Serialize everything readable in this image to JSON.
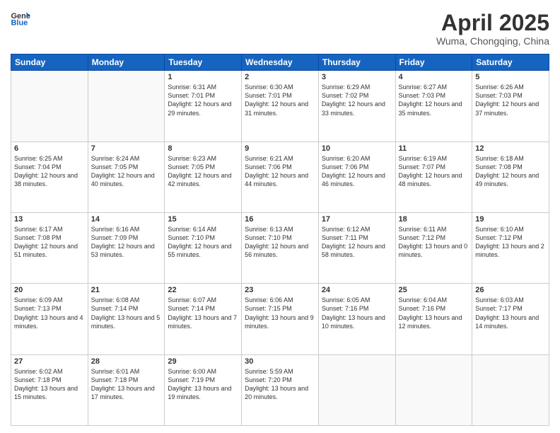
{
  "header": {
    "logo_general": "General",
    "logo_blue": "Blue",
    "title": "April 2025",
    "location": "Wuma, Chongqing, China"
  },
  "days_of_week": [
    "Sunday",
    "Monday",
    "Tuesday",
    "Wednesday",
    "Thursday",
    "Friday",
    "Saturday"
  ],
  "weeks": [
    [
      {
        "day": "",
        "info": ""
      },
      {
        "day": "",
        "info": ""
      },
      {
        "day": "1",
        "info": "Sunrise: 6:31 AM\nSunset: 7:01 PM\nDaylight: 12 hours\nand 29 minutes."
      },
      {
        "day": "2",
        "info": "Sunrise: 6:30 AM\nSunset: 7:01 PM\nDaylight: 12 hours\nand 31 minutes."
      },
      {
        "day": "3",
        "info": "Sunrise: 6:29 AM\nSunset: 7:02 PM\nDaylight: 12 hours\nand 33 minutes."
      },
      {
        "day": "4",
        "info": "Sunrise: 6:27 AM\nSunset: 7:03 PM\nDaylight: 12 hours\nand 35 minutes."
      },
      {
        "day": "5",
        "info": "Sunrise: 6:26 AM\nSunset: 7:03 PM\nDaylight: 12 hours\nand 37 minutes."
      }
    ],
    [
      {
        "day": "6",
        "info": "Sunrise: 6:25 AM\nSunset: 7:04 PM\nDaylight: 12 hours\nand 38 minutes."
      },
      {
        "day": "7",
        "info": "Sunrise: 6:24 AM\nSunset: 7:05 PM\nDaylight: 12 hours\nand 40 minutes."
      },
      {
        "day": "8",
        "info": "Sunrise: 6:23 AM\nSunset: 7:05 PM\nDaylight: 12 hours\nand 42 minutes."
      },
      {
        "day": "9",
        "info": "Sunrise: 6:21 AM\nSunset: 7:06 PM\nDaylight: 12 hours\nand 44 minutes."
      },
      {
        "day": "10",
        "info": "Sunrise: 6:20 AM\nSunset: 7:06 PM\nDaylight: 12 hours\nand 46 minutes."
      },
      {
        "day": "11",
        "info": "Sunrise: 6:19 AM\nSunset: 7:07 PM\nDaylight: 12 hours\nand 48 minutes."
      },
      {
        "day": "12",
        "info": "Sunrise: 6:18 AM\nSunset: 7:08 PM\nDaylight: 12 hours\nand 49 minutes."
      }
    ],
    [
      {
        "day": "13",
        "info": "Sunrise: 6:17 AM\nSunset: 7:08 PM\nDaylight: 12 hours\nand 51 minutes."
      },
      {
        "day": "14",
        "info": "Sunrise: 6:16 AM\nSunset: 7:09 PM\nDaylight: 12 hours\nand 53 minutes."
      },
      {
        "day": "15",
        "info": "Sunrise: 6:14 AM\nSunset: 7:10 PM\nDaylight: 12 hours\nand 55 minutes."
      },
      {
        "day": "16",
        "info": "Sunrise: 6:13 AM\nSunset: 7:10 PM\nDaylight: 12 hours\nand 56 minutes."
      },
      {
        "day": "17",
        "info": "Sunrise: 6:12 AM\nSunset: 7:11 PM\nDaylight: 12 hours\nand 58 minutes."
      },
      {
        "day": "18",
        "info": "Sunrise: 6:11 AM\nSunset: 7:12 PM\nDaylight: 13 hours\nand 0 minutes."
      },
      {
        "day": "19",
        "info": "Sunrise: 6:10 AM\nSunset: 7:12 PM\nDaylight: 13 hours\nand 2 minutes."
      }
    ],
    [
      {
        "day": "20",
        "info": "Sunrise: 6:09 AM\nSunset: 7:13 PM\nDaylight: 13 hours\nand 4 minutes."
      },
      {
        "day": "21",
        "info": "Sunrise: 6:08 AM\nSunset: 7:14 PM\nDaylight: 13 hours\nand 5 minutes."
      },
      {
        "day": "22",
        "info": "Sunrise: 6:07 AM\nSunset: 7:14 PM\nDaylight: 13 hours\nand 7 minutes."
      },
      {
        "day": "23",
        "info": "Sunrise: 6:06 AM\nSunset: 7:15 PM\nDaylight: 13 hours\nand 9 minutes."
      },
      {
        "day": "24",
        "info": "Sunrise: 6:05 AM\nSunset: 7:16 PM\nDaylight: 13 hours\nand 10 minutes."
      },
      {
        "day": "25",
        "info": "Sunrise: 6:04 AM\nSunset: 7:16 PM\nDaylight: 13 hours\nand 12 minutes."
      },
      {
        "day": "26",
        "info": "Sunrise: 6:03 AM\nSunset: 7:17 PM\nDaylight: 13 hours\nand 14 minutes."
      }
    ],
    [
      {
        "day": "27",
        "info": "Sunrise: 6:02 AM\nSunset: 7:18 PM\nDaylight: 13 hours\nand 15 minutes."
      },
      {
        "day": "28",
        "info": "Sunrise: 6:01 AM\nSunset: 7:18 PM\nDaylight: 13 hours\nand 17 minutes."
      },
      {
        "day": "29",
        "info": "Sunrise: 6:00 AM\nSunset: 7:19 PM\nDaylight: 13 hours\nand 19 minutes."
      },
      {
        "day": "30",
        "info": "Sunrise: 5:59 AM\nSunset: 7:20 PM\nDaylight: 13 hours\nand 20 minutes."
      },
      {
        "day": "",
        "info": ""
      },
      {
        "day": "",
        "info": ""
      },
      {
        "day": "",
        "info": ""
      }
    ]
  ]
}
